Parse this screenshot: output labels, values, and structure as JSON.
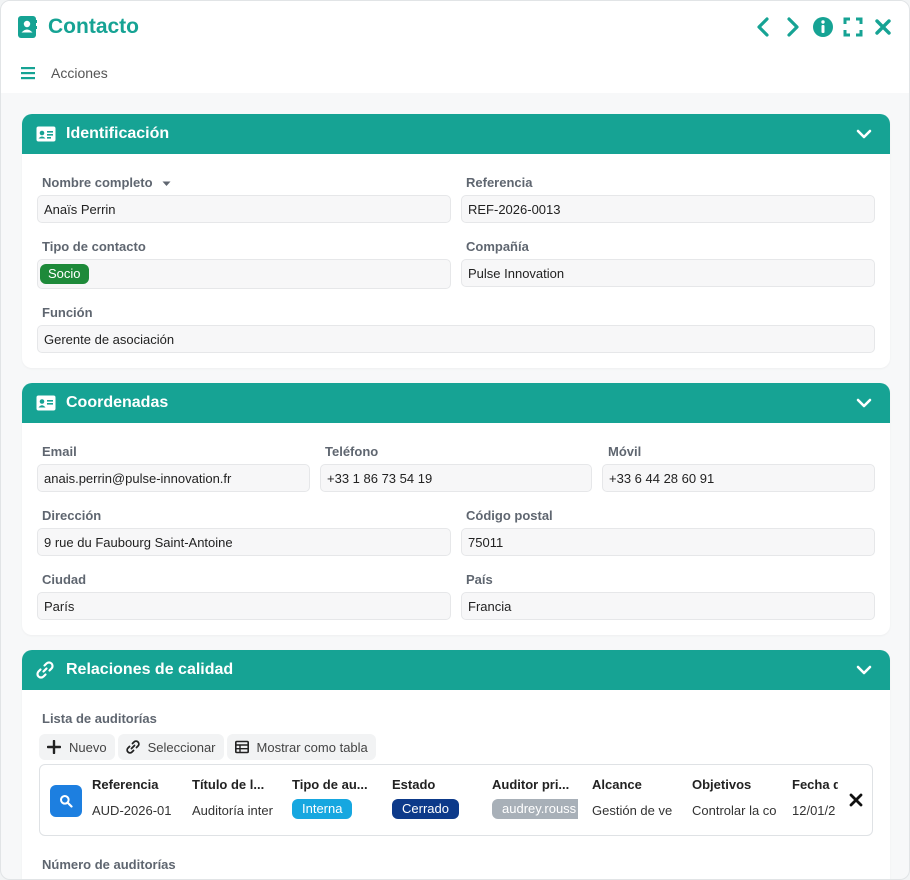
{
  "window": {
    "title": "Contacto",
    "menu_label": "Acciones"
  },
  "colors": {
    "brand": "#16a394",
    "socio_chip": "#1e8a3a",
    "interna_chip": "#16a7e0",
    "cerrado_chip": "#0d3a8a",
    "auditor_chip": "#a8b0b8",
    "search_button": "#1d7fe0"
  },
  "icons": {
    "app": "contact-book-icon",
    "prev": "chevron-left-icon",
    "next": "chevron-right-icon",
    "info": "info-icon",
    "expand": "fullscreen-icon",
    "close": "close-icon",
    "menu": "hamburger-icon"
  },
  "identificacion": {
    "title": "Identificación",
    "nombre_label": "Nombre completo",
    "nombre_value": "Anaïs Perrin",
    "referencia_label": "Referencia",
    "referencia_value": "REF-2026-0013",
    "tipo_label": "Tipo de contacto",
    "tipo_value": "Socio",
    "compania_label": "Compañía",
    "compania_value": "Pulse Innovation",
    "funcion_label": "Función",
    "funcion_value": "Gerente de asociación"
  },
  "coordenadas": {
    "title": "Coordenadas",
    "email_label": "Email",
    "email_value": "anais.perrin@pulse-innovation.fr",
    "telefono_label": "Teléfono",
    "telefono_value": "+33 1 86 73 54 19",
    "movil_label": "Móvil",
    "movil_value": "+33 6 44 28 60 91",
    "direccion_label": "Dirección",
    "direccion_value": "9 rue du Faubourg Saint-Antoine",
    "cp_label": "Código postal",
    "cp_value": "75011",
    "ciudad_label": "Ciudad",
    "ciudad_value": "París",
    "pais_label": "País",
    "pais_value": "Francia"
  },
  "relaciones": {
    "title": "Relaciones de calidad",
    "lista_label": "Lista de auditorías",
    "btn_nuevo": "Nuevo",
    "btn_seleccionar": "Seleccionar",
    "btn_tabla": "Mostrar como tabla",
    "columns": [
      "Referencia",
      "Título de l...",
      "Tipo de au...",
      "Estado",
      "Auditor pri...",
      "Alcance",
      "Objetivos",
      "Fecha d"
    ],
    "row": {
      "referencia": "AUD-2026-01",
      "titulo": "Auditoría inter",
      "tipo": "Interna",
      "estado": "Cerrado",
      "auditor": "audrey.rouss",
      "alcance": "Gestión de ve",
      "objetivos": "Controlar la co",
      "fecha": "12/01/2"
    },
    "numero_label": "Número de auditorías"
  }
}
